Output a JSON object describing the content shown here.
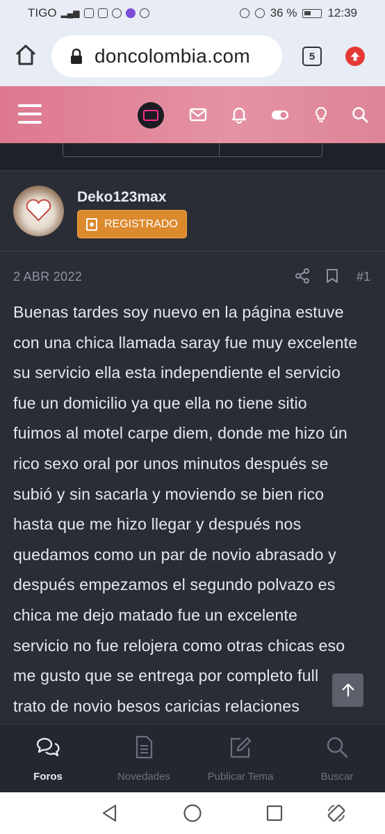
{
  "statusbar": {
    "carrier": "TIGO",
    "battery": "36 %",
    "time": "12:39"
  },
  "browser": {
    "url": "doncolombia.com",
    "tab_count": "5"
  },
  "post": {
    "username": "Deko123max",
    "role_badge": "REGISTRADO",
    "date": "2 ABR 2022",
    "post_number": "#1",
    "body_lines": [
      "Buenas tardes soy nuevo en la página estuve",
      "con una chica llamada saray fue muy excelente",
      "su servicio ella esta independiente el servicio",
      "fue un domicilio ya que ella no tiene sitio",
      "fuimos al motel carpe diem, donde me hizo ún",
      "rico sexo oral por unos minutos después se",
      "subió y sin sacarla y moviendo se bien rico",
      "hasta que me hizo llegar y después nos",
      "quedamos como un par de novio abrasado y",
      "después empezamos el segundo polvazo es",
      "chica me dejo matado fue un excelente",
      "servicio no fue relojera como otras chicas eso",
      "me gusto que se entrega por completo full",
      "trato de novio besos caricias relaciones"
    ]
  },
  "bottom_nav": {
    "items": [
      {
        "label": "Foros",
        "icon": "chat-bubbles-icon",
        "active": true
      },
      {
        "label": "Novedades",
        "icon": "document-icon",
        "active": false
      },
      {
        "label": "Publicar Tema",
        "icon": "edit-icon",
        "active": false
      },
      {
        "label": "Buscar",
        "icon": "search-icon",
        "active": false
      }
    ]
  },
  "colors": {
    "header_pink": "#e08aa0",
    "badge_orange": "#dc8a2e",
    "background": "#2a2d36",
    "body_text": "#e6e8ed",
    "update_red": "#e53935"
  }
}
